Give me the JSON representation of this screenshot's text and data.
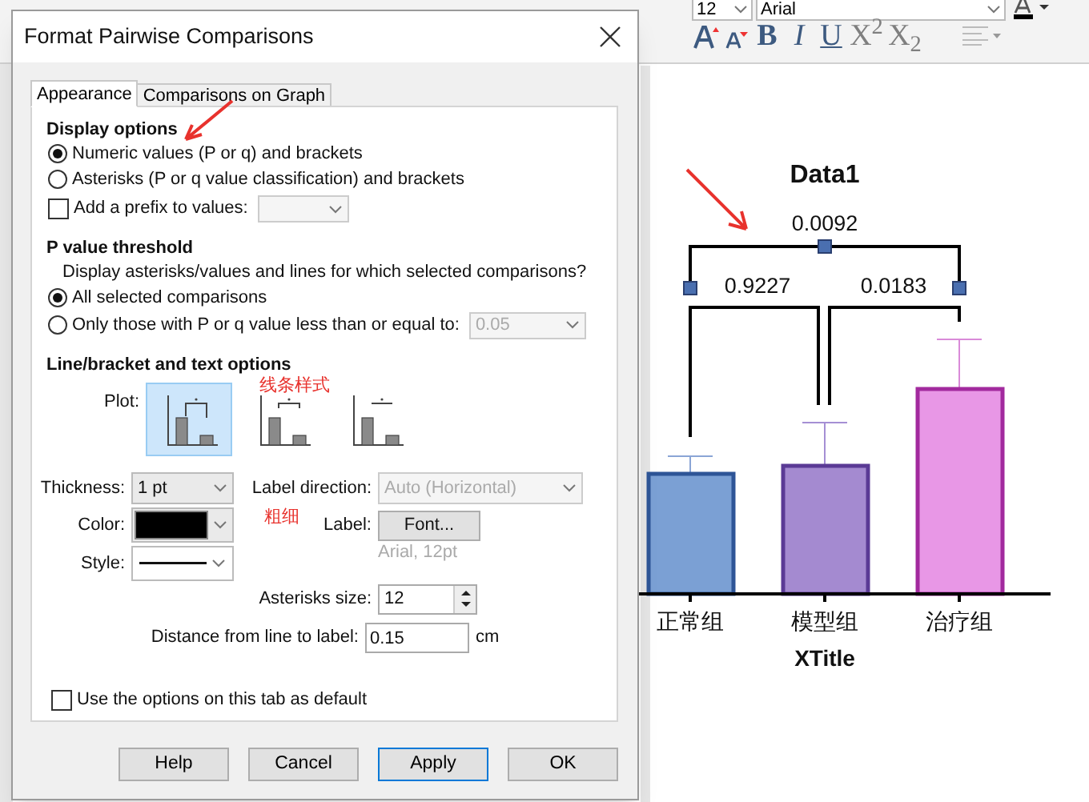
{
  "app_toolbar": {
    "font_size": "12",
    "font_name": "Arial",
    "format_buttons": [
      {
        "kind": "plain",
        "text": "B"
      },
      {
        "kind": "italic",
        "text": "I"
      },
      {
        "kind": "underline",
        "text": "U"
      },
      {
        "kind": "dim",
        "text": "X$^{2}$"
      },
      {
        "kind": "dim",
        "text": "X$_{2}$"
      }
    ]
  },
  "dialog": {
    "title": "Format Pairwise Comparisons",
    "tabs": [
      {
        "label": "Appearance",
        "selected": true
      },
      {
        "label": "Comparisons on Graph",
        "selected": false
      }
    ],
    "display_options": {
      "heading": "Display options",
      "options": [
        {
          "label": "Numeric values (P or q) and brackets",
          "selected": true
        },
        {
          "label": "Asterisks (P or q value classification) and brackets",
          "selected": false
        }
      ],
      "prefix": {
        "label": "Add a prefix to values:",
        "checked": false
      }
    },
    "threshold": {
      "heading": "P value threshold",
      "prompt": "Display asterisks/values and lines for which selected comparisons?",
      "options": [
        {
          "label": "All selected comparisons",
          "selected": true
        },
        {
          "label": "Only those with P or q value less than or equal to:",
          "selected": false
        }
      ],
      "value": "0.05"
    },
    "line_options": {
      "heading": "Line/bracket and text options",
      "plot_label": "Plot:",
      "plot_styles": [
        {
          "kind": "bracket",
          "selected": true
        },
        {
          "kind": "short-bracket",
          "selected": false
        },
        {
          "kind": "line",
          "selected": false
        }
      ],
      "thickness_label": "Thickness:",
      "thickness": "1 pt",
      "color_label": "Color:",
      "color": "#000000",
      "style_label": "Style:",
      "label_direction_label": "Label direction:",
      "label_direction": "Auto (Horizontal)",
      "label_label": "Label:",
      "font_button": "Font...",
      "font_info": "Arial, 12pt",
      "asterisks_size_label": "Asterisks size:",
      "asterisks_size": "12",
      "distance_label": "Distance from line to label:",
      "distance": "0.15",
      "distance_unit": "cm"
    },
    "default_option": {
      "label": "Use the options on this tab as default",
      "checked": false
    },
    "buttons": [
      {
        "label": "Help",
        "focused": false
      },
      {
        "label": "Cancel",
        "focused": false
      },
      {
        "label": "Apply",
        "focused": true
      },
      {
        "label": "OK",
        "focused": false
      }
    ]
  },
  "annotations": [
    {
      "text": "线条样式"
    },
    {
      "text": "粗细"
    }
  ],
  "graph": {
    "title": "Data1",
    "comparisons": [
      "0.0092",
      "0.9227",
      "0.0183"
    ],
    "groups": [
      {
        "label": "正常组",
        "color": "#7ba0d4"
      },
      {
        "label": "模型组",
        "color": "#a48ad0"
      },
      {
        "label": "治疗组",
        "color": "#e897e6"
      }
    ],
    "x_title": "XTitle"
  }
}
